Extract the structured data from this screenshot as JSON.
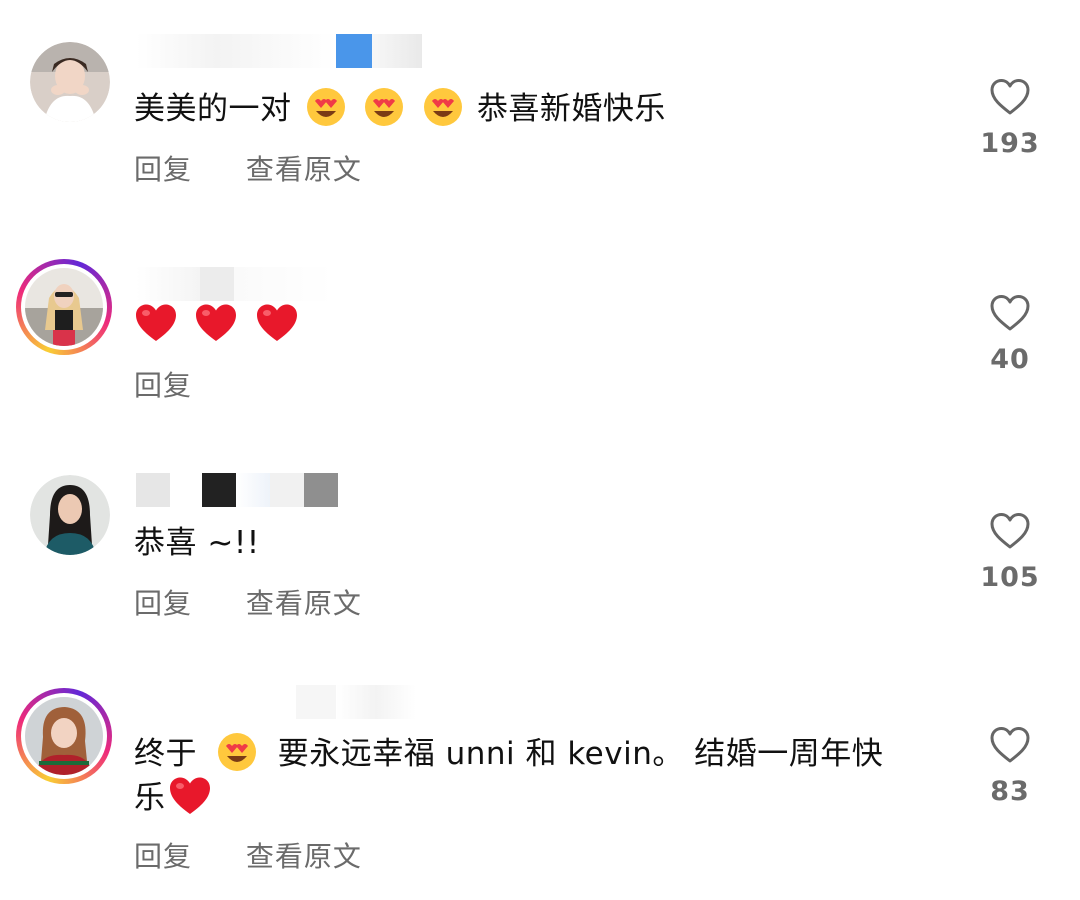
{
  "comments": [
    {
      "text_before": "美美的一对",
      "emojis": [
        "heart-eyes",
        "heart-eyes",
        "heart-eyes"
      ],
      "text_after": "恭喜新婚快乐",
      "reply_label": "回复",
      "translate_label": "查看原文",
      "likes": "193"
    },
    {
      "text_before": "",
      "emojis": [
        "red-heart",
        "red-heart",
        "red-heart"
      ],
      "text_after": "",
      "reply_label": "回复",
      "likes": "40"
    },
    {
      "text_before": "恭喜 ~!!",
      "reply_label": "回复",
      "translate_label": "查看原文",
      "likes": "105"
    },
    {
      "text_before": "终于",
      "text_mid": "要永远幸福 unni 和 kevin。 结婚一周年快",
      "text_line2": "乐",
      "reply_label": "回复",
      "translate_label": "查看原文",
      "likes": "83"
    }
  ],
  "colors": {
    "text": "#111111",
    "secondary": "#6b6b6b",
    "story_ring": [
      "#f9ce34",
      "#ee2a7b",
      "#6228d7"
    ]
  }
}
